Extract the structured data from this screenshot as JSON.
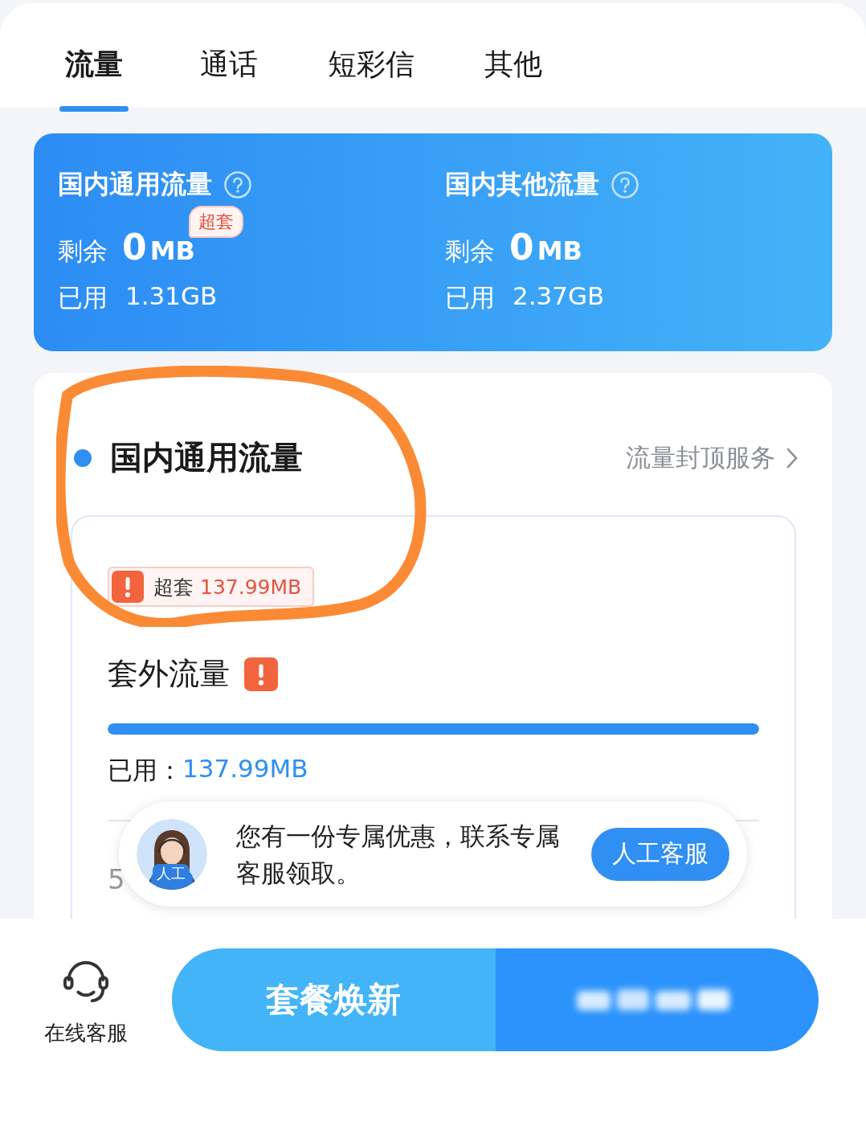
{
  "tabs": [
    {
      "label": "流量",
      "selected": true
    },
    {
      "label": "通话",
      "selected": false
    },
    {
      "label": "短彩信",
      "selected": false
    },
    {
      "label": "其他",
      "selected": false
    }
  ],
  "summary": [
    {
      "title": "国内通用流量",
      "remaining_label": "剩余",
      "remaining_value": "0",
      "remaining_unit": "MB",
      "badge": "超套",
      "used_label": "已用",
      "used_value": "1.31GB"
    },
    {
      "title": "国内其他流量",
      "remaining_label": "剩余",
      "remaining_value": "0",
      "remaining_unit": "MB",
      "used_label": "已用",
      "used_value": "2.37GB"
    }
  ],
  "section": {
    "title": "国内通用流量",
    "link": "流量封顶服务",
    "overage_badge": {
      "label": "超套",
      "value": "137.99MB"
    },
    "item": {
      "title": "套外流量",
      "level": 1,
      "used_label": "已用：",
      "used_value": "137.99MB"
    },
    "next_item": {
      "value": "5"
    }
  },
  "promo": {
    "avatar_label": "人工",
    "message": "您有一份专属优惠，联系专属客服领取。",
    "button": "人工客服"
  },
  "bottom_bar": {
    "service_label": "在线客服",
    "buttons": [
      {
        "kind": "text",
        "label": "套餐焕新"
      },
      {
        "kind": "blurred"
      }
    ]
  }
}
